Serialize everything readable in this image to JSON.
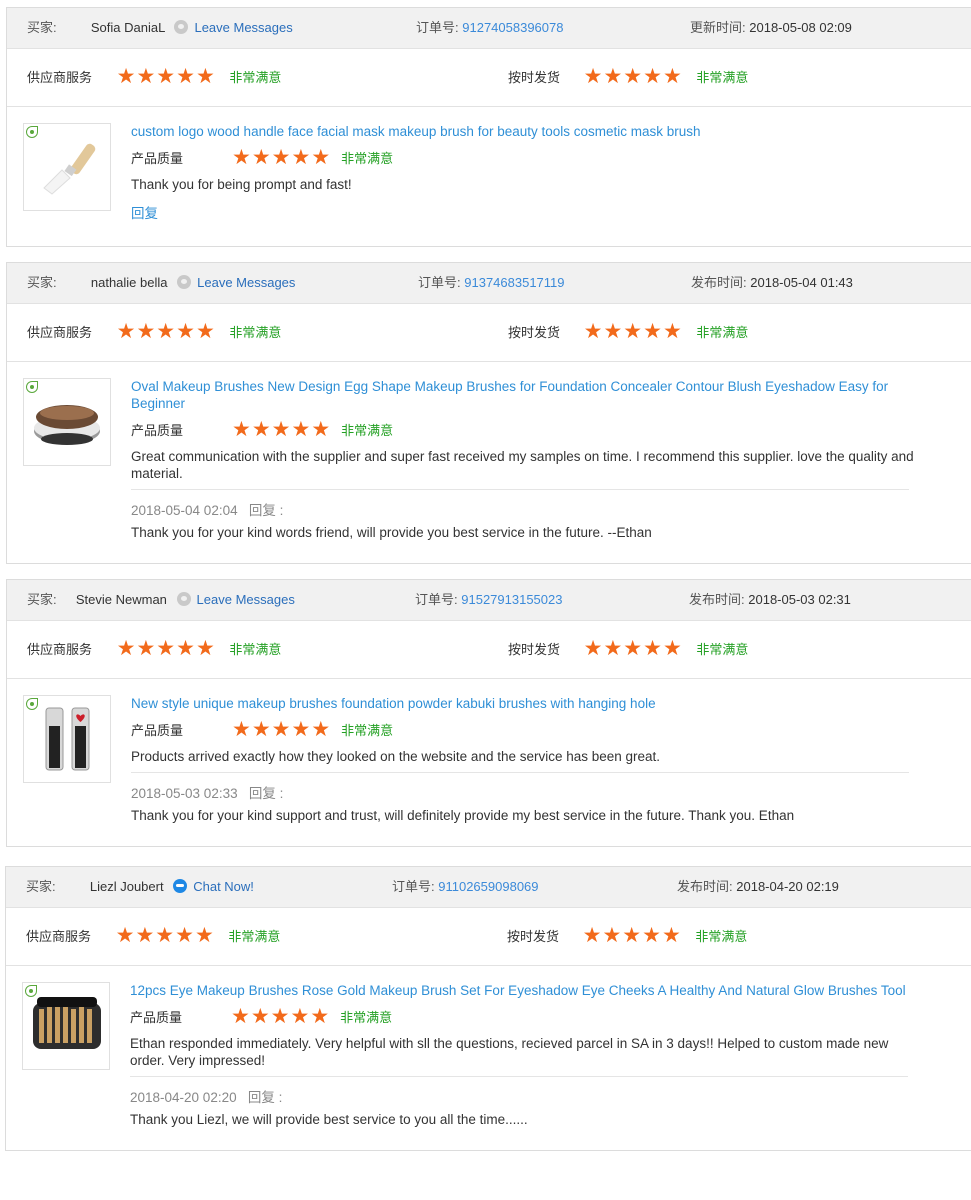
{
  "labels": {
    "buyer": "买家:",
    "order_no": "订单号:",
    "supplier_service": "供应商服务",
    "on_time": "按时发货",
    "quality": "产品质量",
    "reply_link": "回复",
    "reply_meta": "回复 :"
  },
  "colors": {
    "star": "#f26a1b",
    "satisfied": "#23a023",
    "link": "#2f8fd6",
    "header_bg": "#f1f1f1"
  },
  "reviews": [
    {
      "buyer": "Sofia DaniaL",
      "flag": "malaysia",
      "contact_icon": "message-icon",
      "contact_label": "Leave Messages",
      "order_no": "91274058396078",
      "time_label": "更新时间:",
      "time": "2018-05-08 02:09",
      "supplier_service": {
        "stars": 5,
        "text": "非常满意"
      },
      "on_time": {
        "stars": 5,
        "text": "非常满意"
      },
      "product": "custom logo wood handle face facial mask makeup brush for beauty tools cosmetic mask brush",
      "quality": {
        "stars": 5,
        "text": "非常满意"
      },
      "comment": "Thank you for being prompt and fast!",
      "reply": null
    },
    {
      "buyer": "nathalie bella",
      "flag": "canada",
      "contact_icon": "message-icon",
      "contact_label": "Leave Messages",
      "order_no": "91374683517119",
      "time_label": "发布时间:",
      "time": "2018-05-04 01:43",
      "supplier_service": {
        "stars": 5,
        "text": "非常满意"
      },
      "on_time": {
        "stars": 5,
        "text": "非常满意"
      },
      "product": "Oval Makeup Brushes New Design Egg Shape Makeup Brushes for Foundation Concealer Contour Blush Eyeshadow Easy for Beginner",
      "quality": {
        "stars": 5,
        "text": "非常满意"
      },
      "comment": "Great communication with the supplier and super fast received my samples on time. I recommend this supplier. love the quality and material.",
      "reply": {
        "time": "2018-05-04 02:04",
        "text": "Thank you for your kind words friend, will provide you best service in the future. --Ethan"
      }
    },
    {
      "buyer": "Stevie Newman",
      "flag": "none",
      "contact_icon": "message-icon",
      "contact_label": "Leave Messages",
      "order_no": "91527913155023",
      "time_label": "发布时间:",
      "time": "2018-05-03 02:31",
      "supplier_service": {
        "stars": 5,
        "text": "非常满意"
      },
      "on_time": {
        "stars": 5,
        "text": "非常满意"
      },
      "product": "New style unique makeup brushes foundation powder kabuki brushes with hanging hole",
      "quality": {
        "stars": 5,
        "text": "非常满意"
      },
      "comment": "Products arrived exactly how they looked on the website and the service has been great.",
      "reply": {
        "time": "2018-05-03 02:33",
        "text": "Thank you for your kind support and trust, will definitely provide my best service in the future. Thank you. Ethan"
      }
    },
    {
      "buyer": "Liezl Joubert",
      "flag": "south-africa",
      "contact_icon": "chat-icon",
      "contact_label": "Chat Now!",
      "order_no": "91102659098069",
      "time_label": "发布时间:",
      "time": "2018-04-20 02:19",
      "supplier_service": {
        "stars": 5,
        "text": "非常满意"
      },
      "on_time": {
        "stars": 5,
        "text": "非常满意"
      },
      "product": "12pcs Eye Makeup Brushes Rose Gold Makeup Brush Set For Eyeshadow Eye Cheeks A Healthy And Natural Glow Brushes Tool",
      "quality": {
        "stars": 5,
        "text": "非常满意"
      },
      "comment": "Ethan responded immediately. Very helpful with sll the questions, recieved parcel in SA in 3 days!! Helped to custom made new order. Very impressed!",
      "reply": {
        "time": "2018-04-20 02:20",
        "text": "Thank you Liezl, we will provide best service to you all the time......"
      }
    }
  ]
}
